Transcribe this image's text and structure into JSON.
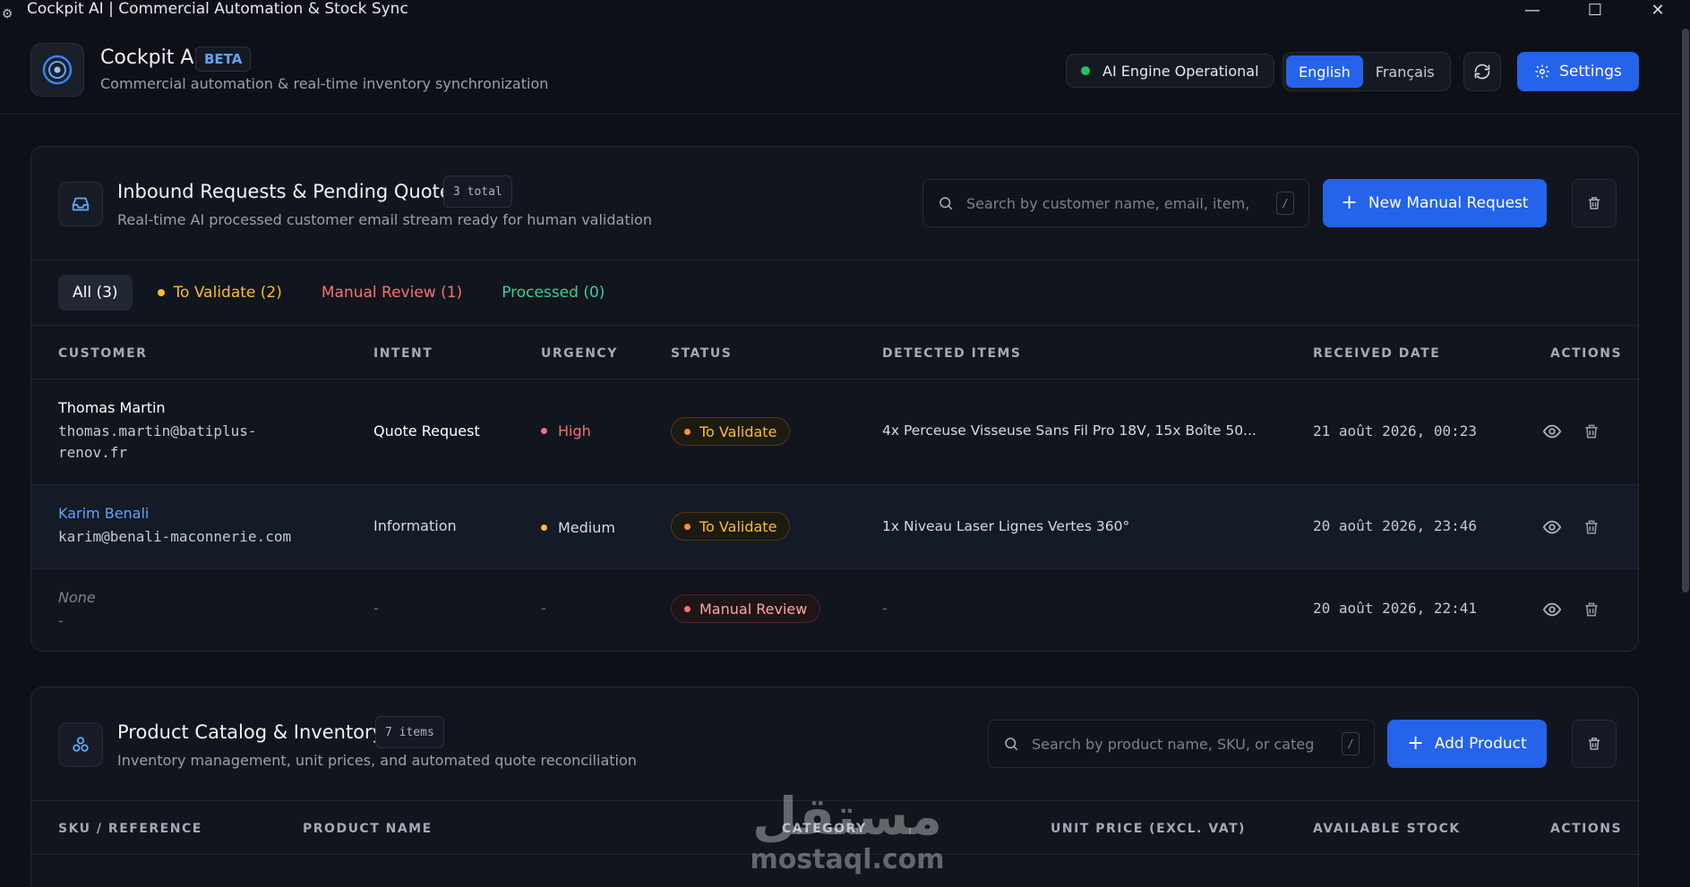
{
  "window": {
    "title": "Cockpit AI | Commercial Automation & Stock Sync"
  },
  "header": {
    "brand": "Cockpit AI",
    "beta": "BETA",
    "subtitle": "Commercial automation & real-time inventory synchronization",
    "engine_status": "AI Engine Operational",
    "languages": [
      "English",
      "Français"
    ],
    "active_language": "English",
    "settings_label": "Settings"
  },
  "requests": {
    "title": "Inbound Requests & Pending Quotes",
    "count": "3 total",
    "subtitle": "Real-time AI processed customer email stream ready for human validation",
    "search_placeholder": "Search by customer name, email, item,",
    "search_shortcut": "/",
    "new_button": "New Manual Request",
    "tabs": [
      "All (3)",
      "To Validate (2)",
      "Manual Review (1)",
      "Processed (0)"
    ],
    "columns": [
      "CUSTOMER",
      "INTENT",
      "URGENCY",
      "STATUS",
      "DETECTED ITEMS",
      "RECEIVED DATE",
      "ACTIONS"
    ],
    "rows": [
      {
        "name": "Thomas Martin",
        "email_1": "thomas.martin@batiplus-",
        "email_2": "renov.fr",
        "intent": "Quote Request",
        "urgency": "High",
        "status": "To Validate",
        "items": "4x Perceuse Visseuse Sans Fil Pro 18V, 15x Boîte 50...",
        "date": "21 août 2026, 00:23"
      },
      {
        "name": "Karim Benali",
        "email_1": "karim@benali-maconnerie.com",
        "email_2": "",
        "intent": "Information",
        "urgency": "Medium",
        "status": "To Validate",
        "items": "1x Niveau Laser Lignes Vertes 360°",
        "date": "20 août 2026, 23:46"
      },
      {
        "name": "None",
        "email_1": "-",
        "email_2": "",
        "intent": "-",
        "urgency": "-",
        "status": "Manual Review",
        "items": "-",
        "date": "20 août 2026, 22:41"
      }
    ]
  },
  "catalog": {
    "title": "Product Catalog & Inventory",
    "count": "7 items",
    "subtitle": "Inventory management, unit prices, and automated quote reconciliation",
    "search_placeholder": "Search by product name, SKU, or categ",
    "search_shortcut": "/",
    "add_button": "Add Product",
    "columns": [
      "SKU / REFERENCE",
      "PRODUCT NAME",
      "CATEGORY",
      "UNIT PRICE (EXCL. VAT)",
      "AVAILABLE STOCK",
      "ACTIONS"
    ]
  },
  "watermark": {
    "arabic": "مستقل",
    "latin": "mostaql.com"
  },
  "colors": {
    "accent": "#2563eb",
    "success": "#22c55e",
    "warning": "#fbbf24",
    "danger": "#f87171"
  }
}
